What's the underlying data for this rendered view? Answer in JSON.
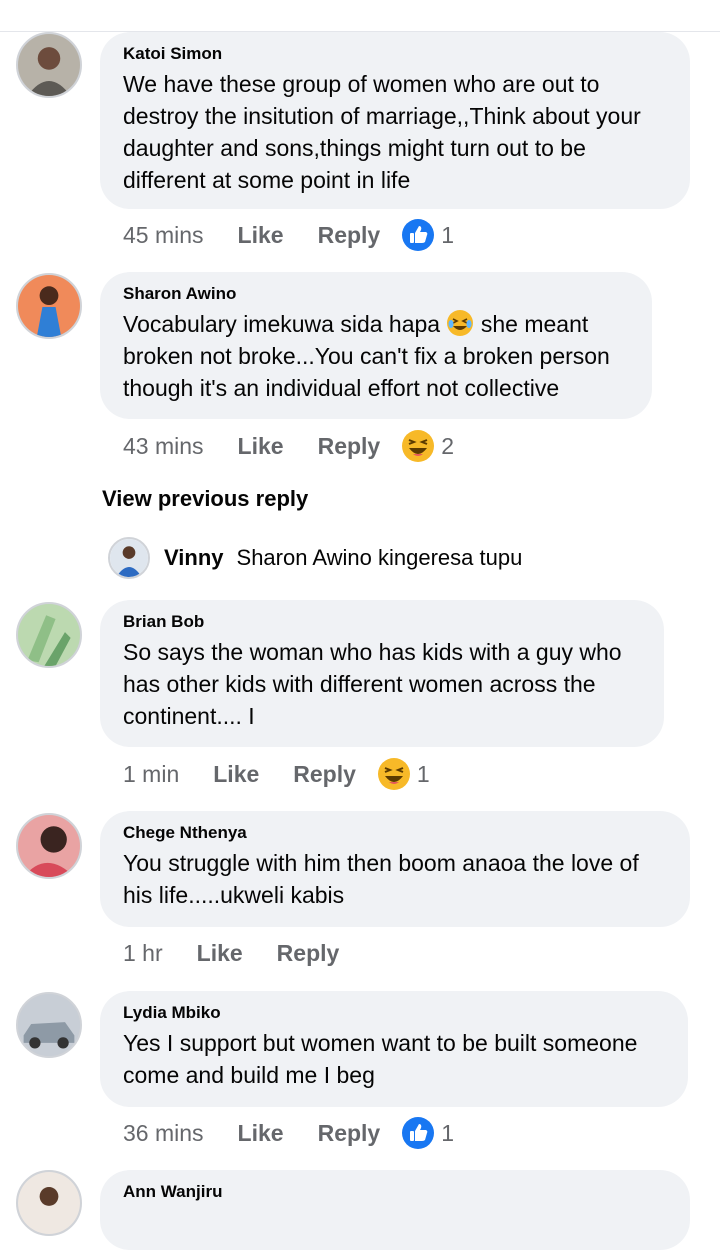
{
  "comments": [
    {
      "author": "Katoi Simon",
      "text": "We have these group of women who are out to destroy the insitution of marriage,,Think about your daughter and sons,things might turn out to be different at some point in life",
      "time": "45 mins",
      "like": "Like",
      "reply": "Reply",
      "reaction": "like-icon",
      "count": "1"
    },
    {
      "author": "Sharon Awino",
      "text_before_emoji": "Vocabulary imekuwa sida  hapa ",
      "text_after_emoji": " she meant broken not broke...You can't fix a broken person though it's an individual effort not collective",
      "time": "43 mins",
      "like": "Like",
      "reply": "Reply",
      "reaction": "laugh-icon",
      "count": "2"
    },
    {
      "author": "Brian Bob",
      "text": "So says the woman who has kids with a guy who has other kids with different women across the continent.... I",
      "time": "1 min",
      "like": "Like",
      "reply": "Reply",
      "reaction": "laugh-icon",
      "count": "1"
    },
    {
      "author": "Chege Nthenya",
      "text": "You struggle with him then boom anaoa the love of his life.....ukweli kabis",
      "time": "1 hr",
      "like": "Like",
      "reply": "Reply"
    },
    {
      "author": "Lydia Mbiko",
      "text": "Yes I support but women want to be built someone come and build me I beg",
      "time": "36 mins",
      "like": "Like",
      "reply": "Reply",
      "reaction": "like-icon",
      "count": "1"
    },
    {
      "author": "Ann Wanjiru"
    }
  ],
  "view_previous": "View previous reply",
  "nested_reply": {
    "author": "Vinny",
    "text": "Sharon Awino kingeresa tupu"
  },
  "colors": {
    "bubble": "#f0f2f5",
    "meta_text": "#65676b",
    "like_blue": "#1877f2",
    "laugh_yellow": "#f7b928"
  }
}
